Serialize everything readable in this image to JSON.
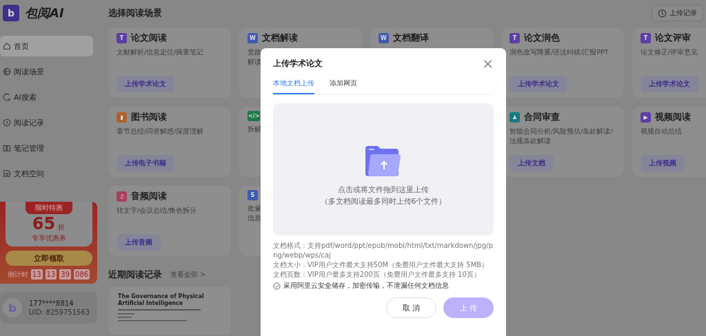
{
  "brand": {
    "logo_letter": "b",
    "name": "包阅AI"
  },
  "nav": [
    {
      "label": "首页",
      "selected": true
    },
    {
      "label": "阅读场景",
      "selected": false
    },
    {
      "label": "AI搜索",
      "selected": false
    },
    {
      "label": "阅读记录",
      "selected": false
    },
    {
      "label": "笔记管理",
      "selected": false
    },
    {
      "label": "文档空间",
      "selected": false
    }
  ],
  "promo": {
    "banner": "限时特惠",
    "discount": "65",
    "unit": "折",
    "caption": "专享优惠券",
    "button": "立即领取",
    "countdown_label": "倒计时",
    "countdown": [
      "13",
      "13",
      "39",
      "086"
    ]
  },
  "user": {
    "avatar_letter": "b",
    "phone": "177****8814",
    "uid": "UID:  8259751563"
  },
  "main": {
    "title": "选择阅读场景",
    "upload_record": "上传记录",
    "cards": [
      {
        "icon": "T",
        "color": "#5b3fa3",
        "title": "论文阅读",
        "desc": [
          "文献解析/信息定位/摘要笔记"
        ],
        "button": "上传学术论文"
      },
      {
        "icon": "W",
        "color": "#3f5bb0",
        "title": "文档解读",
        "desc": [
          "党政",
          "解读"
        ]
      },
      {
        "icon": "W",
        "color": "#3f5bb0",
        "title": "文档翻译"
      },
      {
        "icon": "T",
        "color": "#5b3fa3",
        "title": "论文润色",
        "desc": [
          "润色改写降重/语法纠错/汇报PPT"
        ],
        "button": "上传学术论文"
      },
      {
        "icon": "T",
        "color": "#5b3fa3",
        "title": "论文评审",
        "desc": [
          "论文修正/评审意见"
        ],
        "button": "上传学术论文"
      },
      {
        "icon": "▮",
        "color": "#b0602a",
        "title": "图书阅读",
        "desc": [
          "章节总结/问答解惑/深度理解"
        ],
        "button": "上传电子书籍"
      },
      {
        "icon": "</>",
        "color": "#1f7a48",
        "desc": [
          "拆解"
        ]
      },
      {
        "icon": "♟",
        "color": "#177a82",
        "title": "合同审查",
        "desc": [
          "智能合同分析/风险预估/条款解读/",
          "法规条款解读"
        ],
        "button": "上传文档"
      },
      {
        "icon": "▶",
        "color": "#5b3fa3",
        "title": "视频阅读",
        "desc": [
          "视频自动总结"
        ],
        "button": "上传视频"
      },
      {
        "icon": "♫",
        "color": "#a8405f",
        "title": "音频阅读",
        "desc": [
          "转文字/会议总结/角色拆分"
        ],
        "button": "上传音频"
      },
      {
        "icon": "S",
        "color": "#3f5bb0",
        "desc": [
          "批量",
          "信息"
        ]
      }
    ],
    "recent_title": "近期阅读记录",
    "view_all": "查看全部  >",
    "recent_doc": {
      "title": "The Governance of Physical Artificial Intelligence"
    }
  },
  "modal": {
    "title": "上传学术论文",
    "close": "×",
    "tabs": [
      {
        "label": "本地文档上传",
        "selected": true
      },
      {
        "label": "添加网页",
        "selected": false
      }
    ],
    "drop_text": "点击或将文件拖到这里上传",
    "drop_hint": "（多文档阅读最多同时上传6个文件）",
    "info": [
      "文档格式：支持pdf/word/ppt/epub/mobi/html/txt/markdown/jpg/png/webp/wps/caj",
      "文档大小：VIP用户文件最大支持50M（免费用户文件最大支持 5MB）",
      "文档页数：VIP用户最多支持200页（免费用户文件最多支持 10页）"
    ],
    "secure": "采用阿里云安全储存，加密传输，不泄漏任何文档信息",
    "cancel": "取 消",
    "submit": {
      "label": "上 传",
      "disabled": true
    }
  }
}
